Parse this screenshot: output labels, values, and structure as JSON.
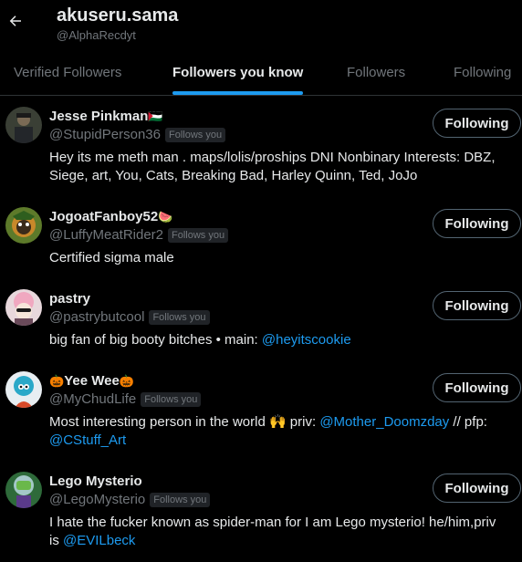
{
  "header": {
    "title": "akuseru.sama",
    "handle": "@AlphaRecdyt"
  },
  "tabs": [
    {
      "label": "Verified Followers",
      "active": false
    },
    {
      "label": "Followers you know",
      "active": true
    },
    {
      "label": "Followers",
      "active": false
    },
    {
      "label": "Following",
      "active": false
    }
  ],
  "follows_you_label": "Follows you",
  "users": [
    {
      "name": "Jesse Pinkman",
      "name_suffix": "🇵🇸",
      "handle": "@StupidPerson36",
      "button": "Following",
      "bio": [
        {
          "text": "Hey its me meth man . maps/lolis/proships DNI Nonbinary Interests: DBZ, Siege, art, You, Cats, Breaking Bad, Harley Quinn, Ted, JoJo"
        }
      ]
    },
    {
      "name": "JogoatFanboy52",
      "name_suffix": "🍉",
      "handle": "@LuffyMeatRider2",
      "button": "Following",
      "bio": [
        {
          "text": "Certified sigma male"
        }
      ]
    },
    {
      "name": "pastry",
      "name_suffix": "",
      "handle": "@pastrybutcool",
      "button": "Following",
      "bio": [
        {
          "text": "big fan of big booty bitches • main: "
        },
        {
          "text": "@heyitscookie",
          "link": true
        }
      ]
    },
    {
      "name_prefix": "🎃",
      "name": "Yee Wee",
      "name_suffix": "🎃",
      "handle": "@MyChudLife",
      "button": "Following",
      "bio": [
        {
          "text": "Most interesting person in the world 🙌 priv: "
        },
        {
          "text": "@Mother_Doomzday",
          "link": true
        },
        {
          "text": " // pfp: "
        },
        {
          "text": "@CStuff_Art",
          "link": true
        }
      ]
    },
    {
      "name": "Lego Mysterio",
      "name_suffix": "",
      "handle": "@LegoMysterio",
      "button": "Following",
      "bio": [
        {
          "text": "I hate the fucker known as spider-man for I am Lego mysterio! he/him,priv is "
        },
        {
          "text": "@EVILbeck",
          "link": true
        }
      ]
    }
  ],
  "colors": {
    "accent": "#1d9bf0",
    "text": "#e7e9ea",
    "muted": "#71767b",
    "border": "#2f3336"
  }
}
